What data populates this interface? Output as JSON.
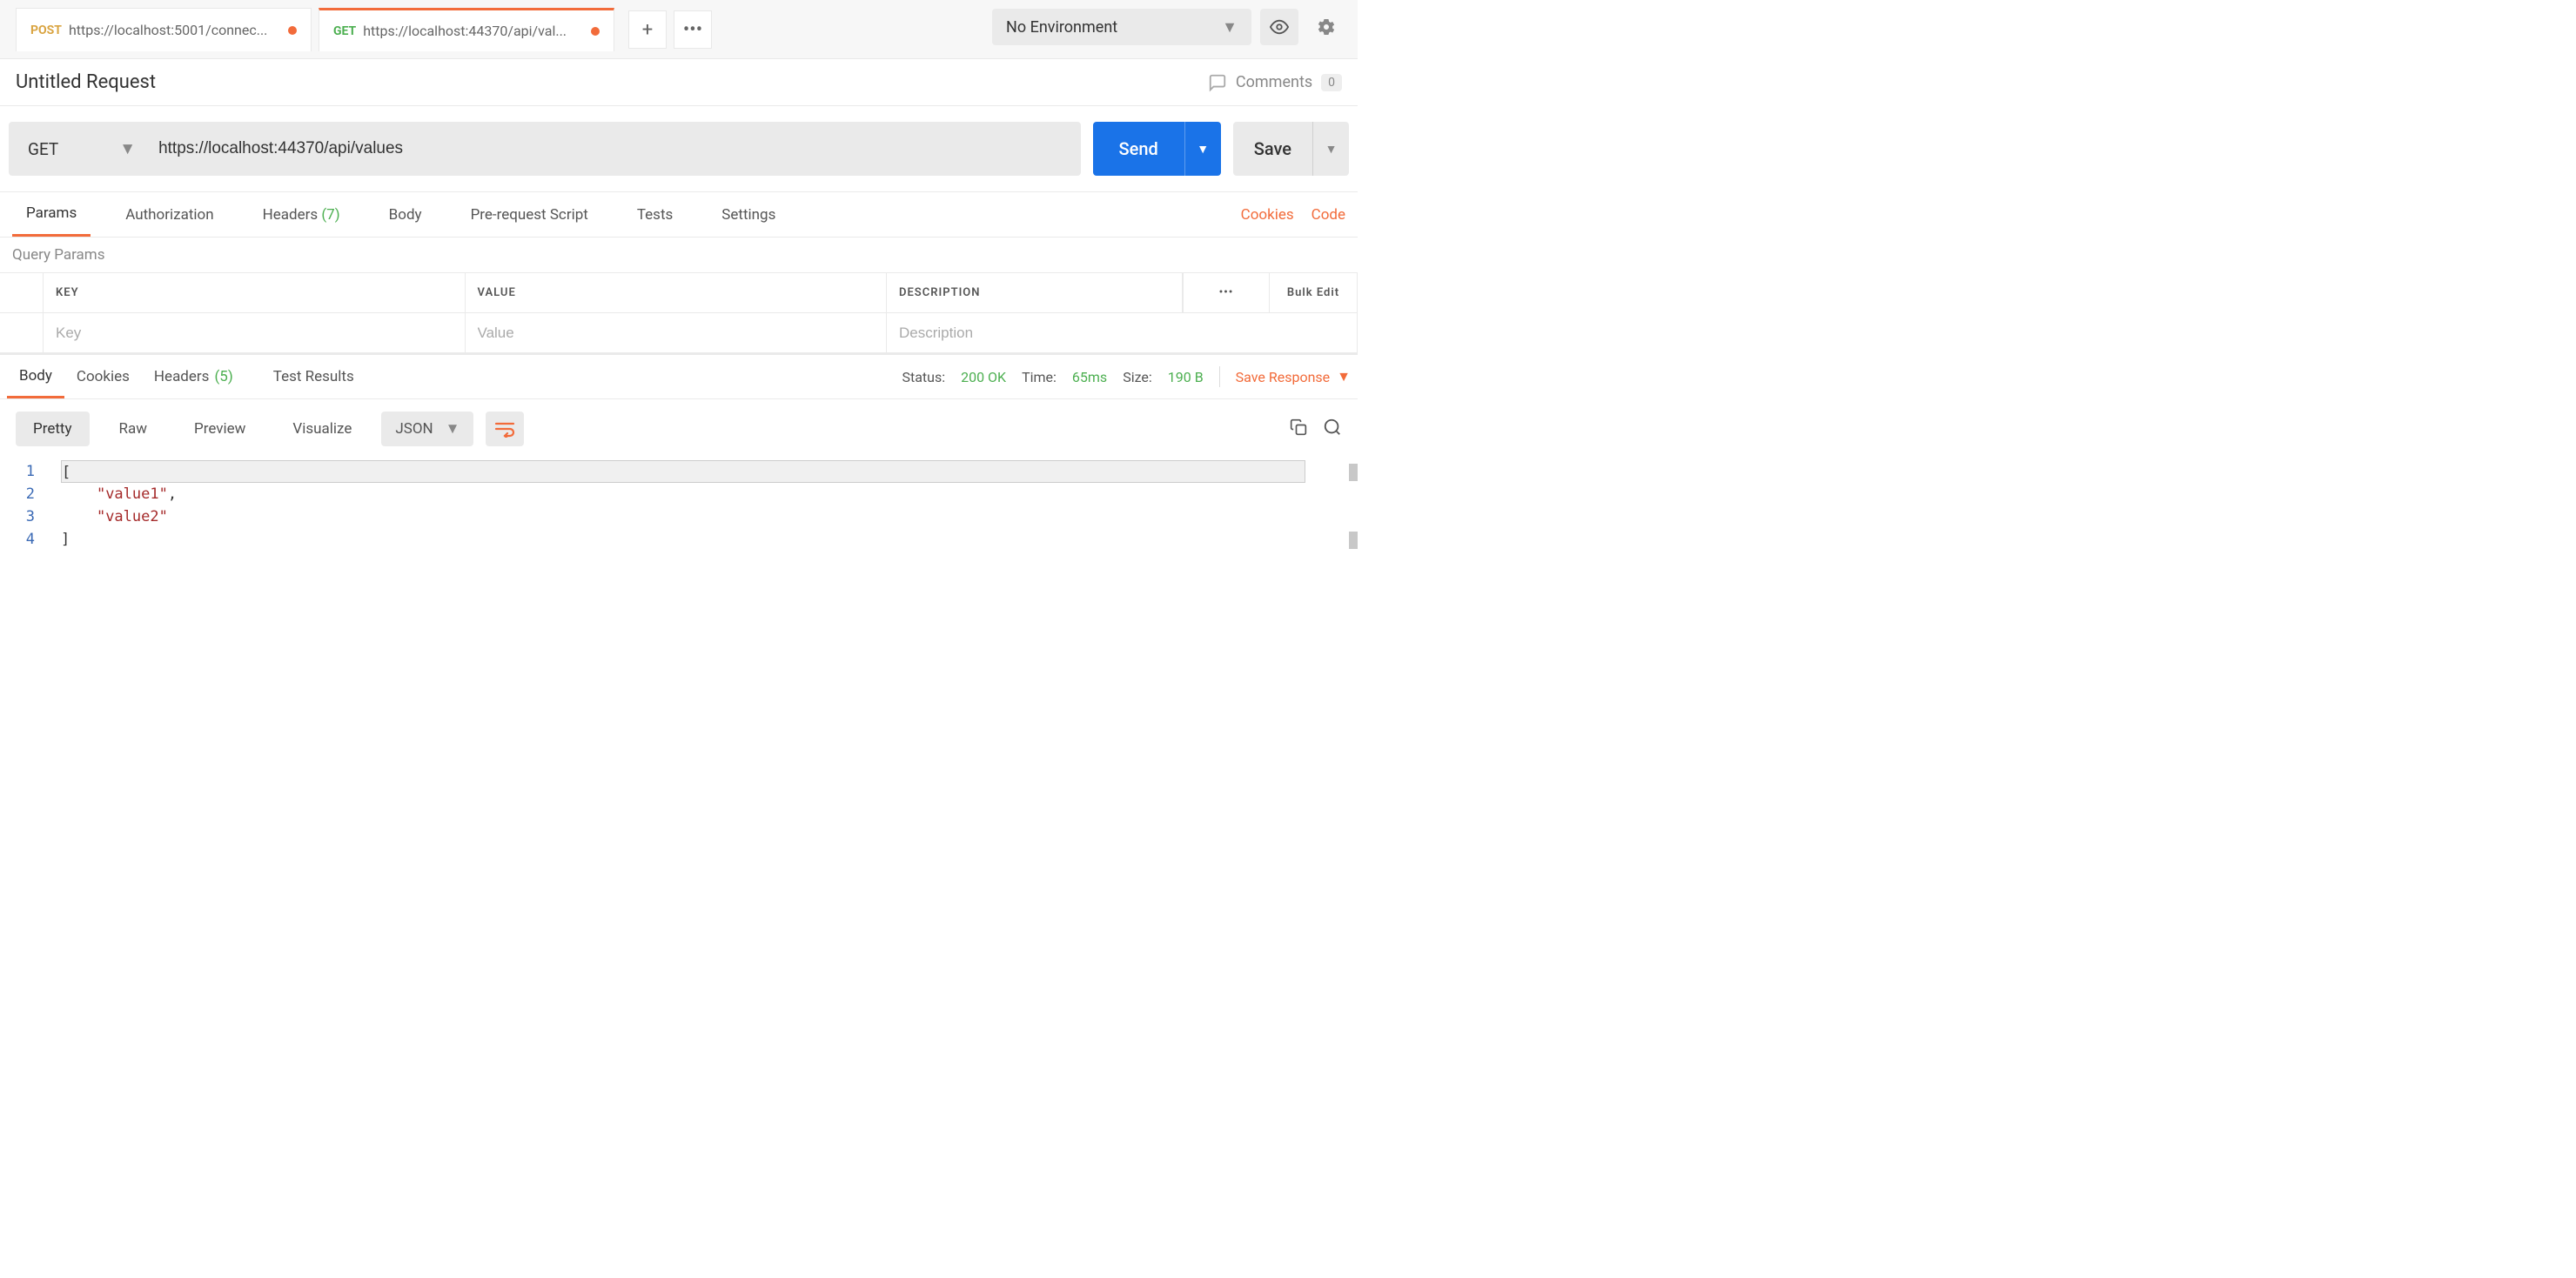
{
  "environment": {
    "selected": "No Environment"
  },
  "tabs": [
    {
      "method": "POST",
      "url": "https://localhost:5001/connec...",
      "modified": true
    },
    {
      "method": "GET",
      "url": "https://localhost:44370/api/val...",
      "modified": true,
      "active": true
    }
  ],
  "request": {
    "title": "Untitled Request",
    "comments_label": "Comments",
    "comments_count": "0",
    "method": "GET",
    "url": "https://localhost:44370/api/values",
    "send_label": "Send",
    "save_label": "Save"
  },
  "request_tabs": {
    "items": [
      {
        "label": "Params",
        "active": true
      },
      {
        "label": "Authorization"
      },
      {
        "label": "Headers",
        "count": "(7)"
      },
      {
        "label": "Body"
      },
      {
        "label": "Pre-request Script"
      },
      {
        "label": "Tests"
      },
      {
        "label": "Settings"
      }
    ],
    "cookies": "Cookies",
    "code": "Code"
  },
  "params": {
    "title": "Query Params",
    "headers": {
      "key": "KEY",
      "value": "VALUE",
      "description": "DESCRIPTION"
    },
    "placeholders": {
      "key": "Key",
      "value": "Value",
      "description": "Description"
    },
    "bulk_edit": "Bulk Edit"
  },
  "response": {
    "tabs": [
      {
        "label": "Body",
        "active": true
      },
      {
        "label": "Cookies"
      },
      {
        "label": "Headers",
        "count": "(5)"
      },
      {
        "label": "Test Results"
      }
    ],
    "status_label": "Status:",
    "status_value": "200 OK",
    "time_label": "Time:",
    "time_value": "65ms",
    "size_label": "Size:",
    "size_value": "190 B",
    "save_response": "Save Response"
  },
  "body_controls": {
    "views": [
      {
        "label": "Pretty",
        "active": true
      },
      {
        "label": "Raw"
      },
      {
        "label": "Preview"
      },
      {
        "label": "Visualize"
      }
    ],
    "format": "JSON"
  },
  "code": {
    "lines": [
      "1",
      "2",
      "3",
      "4"
    ],
    "content": {
      "l1": "[",
      "l2_indent": "    ",
      "l2_str": "\"value1\"",
      "l2_end": ",",
      "l3_indent": "    ",
      "l3_str": "\"value2\"",
      "l4": "]"
    }
  }
}
